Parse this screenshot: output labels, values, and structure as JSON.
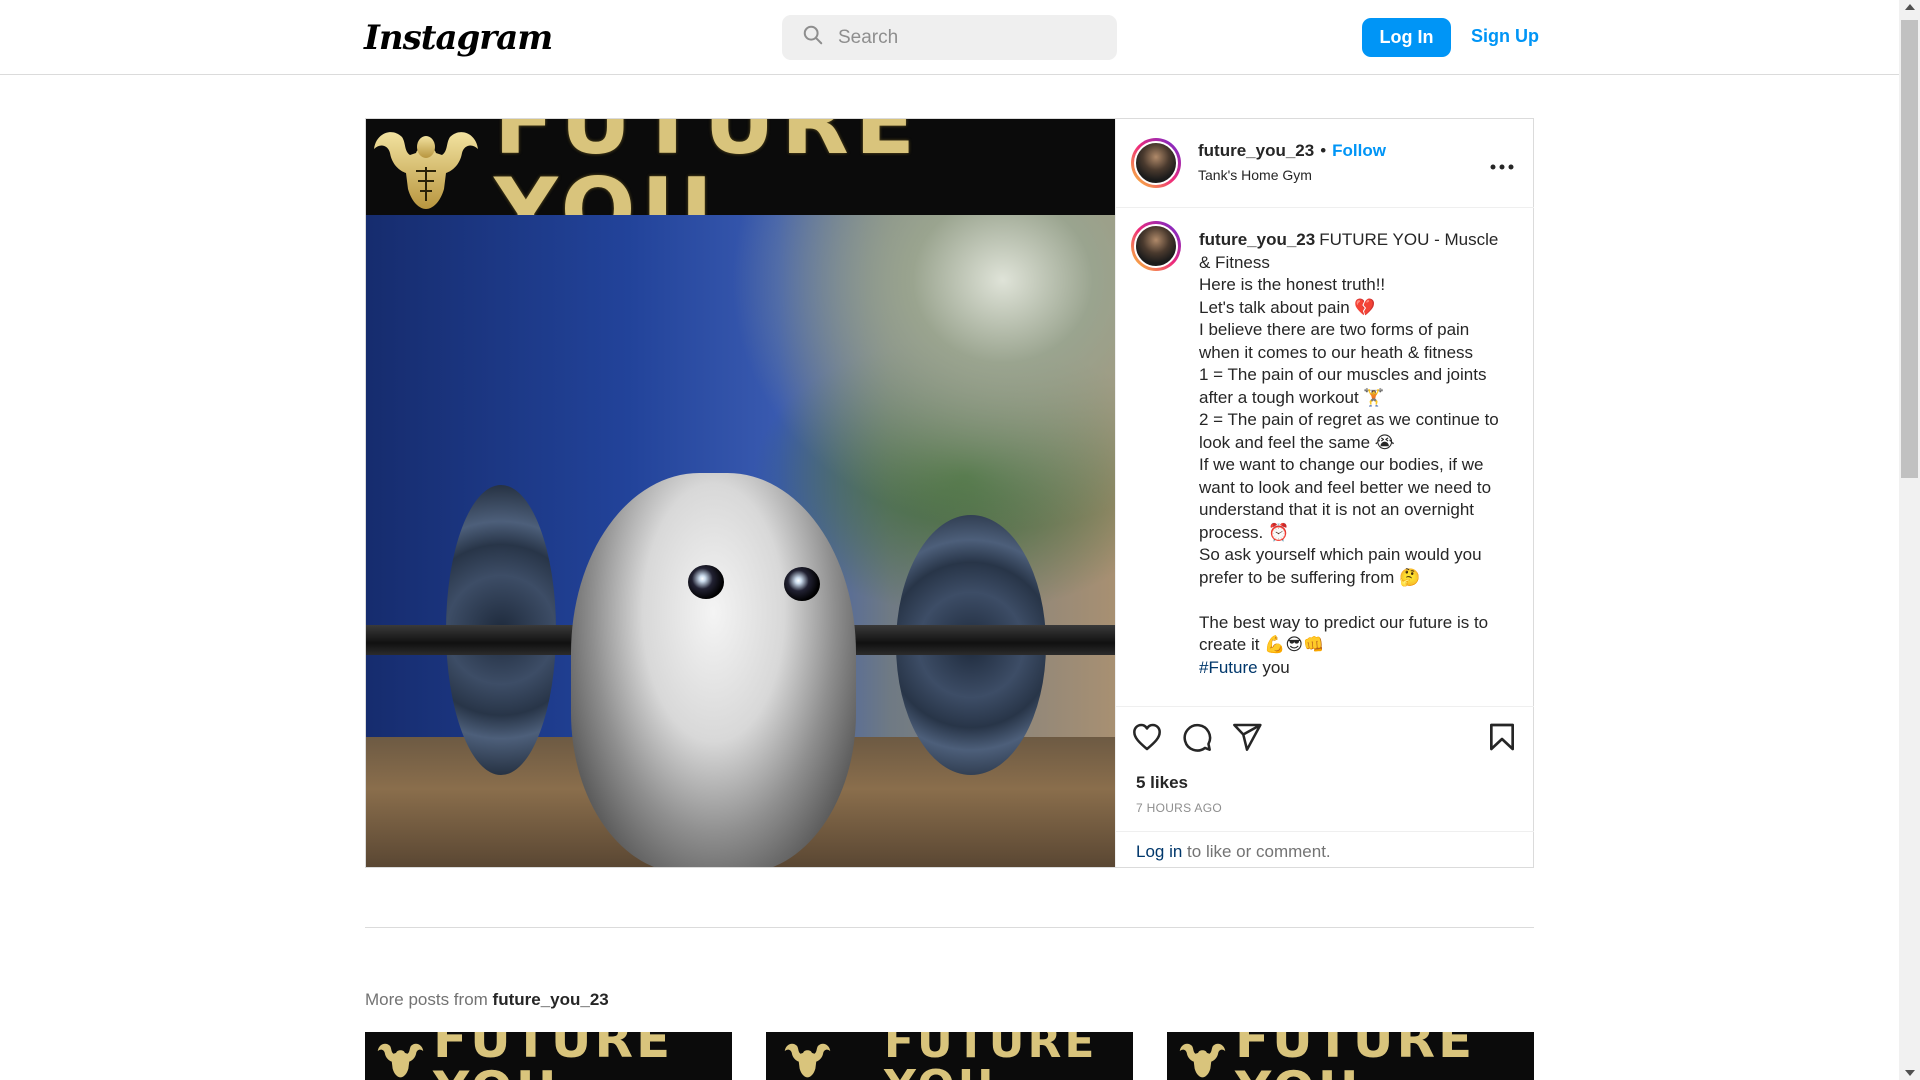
{
  "header": {
    "logo": "Instagram",
    "search_placeholder": "Search",
    "login_label": "Log In",
    "signup_label": "Sign Up"
  },
  "post": {
    "image": {
      "banner_text": "FUTURE YOU",
      "alt": "Kitten lifting a barbell"
    },
    "author": {
      "username": "future_you_23",
      "follow_label": "Follow",
      "separator": "•",
      "location": "Tank's Home Gym"
    },
    "more_icon": "more-horizontal-icon",
    "caption": {
      "username": "future_you_23",
      "text": "FUTURE YOU - Muscle & Fitness\nHere is the honest truth!!\nLet's talk about pain 💔\nI believe there are two forms of pain when it comes to our heath & fitness\n1 = The pain of our muscles and joints after a tough workout 🏋️\n2 = The pain of regret as we continue to look and feel the same 😭\nIf we want to change our bodies, if we want to look and feel better we need to understand that it is not an overnight process. ⏰\nSo ask yourself which pain would you prefer to be suffering from 🤔\n\nThe best way to predict our future is to create it 💪😎👊\n",
      "hashtag": "#Future",
      "hashtag_suffix": " you"
    },
    "actions": {
      "like_icon": "heart-icon",
      "comment_icon": "comment-icon",
      "share_icon": "share-icon",
      "save_icon": "bookmark-icon"
    },
    "likes": "5 likes",
    "time": "7 HOURS AGO",
    "login_prompt": {
      "link": "Log in",
      "text": " to like or comment."
    }
  },
  "more_posts": {
    "label": "More posts from ",
    "username": "future_you_23",
    "thumbs": [
      {
        "banner_text": "FUTURE YOU"
      },
      {
        "banner_text": "FUTURE YOU"
      },
      {
        "banner_text": "FUTURE YOU"
      }
    ]
  },
  "colors": {
    "accent": "#0095f6",
    "link": "#00376b",
    "border": "#dbdbdb",
    "banner_gold": "#d9c47c"
  }
}
